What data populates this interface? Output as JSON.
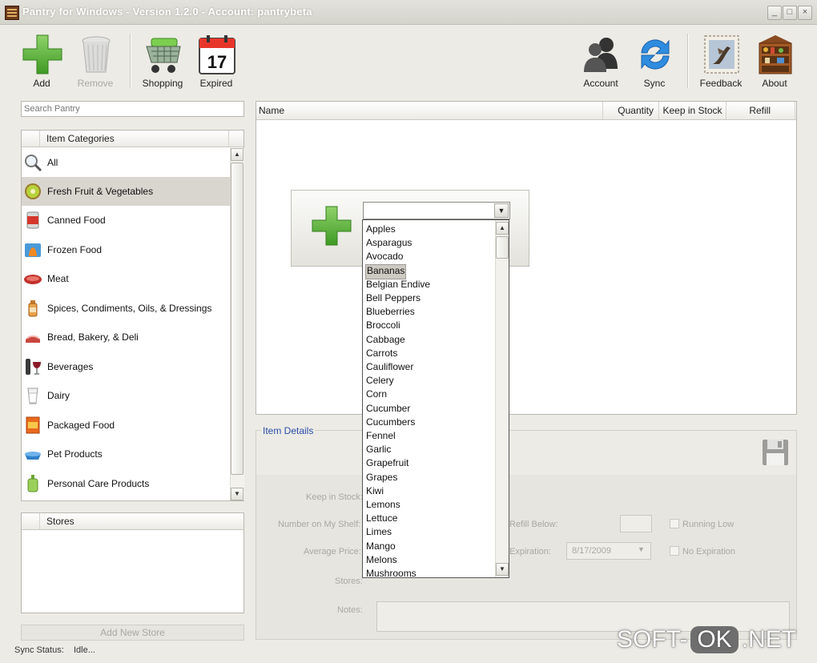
{
  "window": {
    "title": "Pantry for Windows - Version 1.2.0 - Account: pantrybeta",
    "controls": {
      "minimize": "_",
      "maximize": "□",
      "close": "×"
    }
  },
  "toolbar": {
    "left": [
      {
        "label": "Add",
        "icon": "plus-icon",
        "enabled": true
      },
      {
        "label": "Remove",
        "icon": "trash-icon",
        "enabled": false
      },
      {
        "label": "Shopping",
        "icon": "cart-icon",
        "enabled": true
      },
      {
        "label": "Expired",
        "icon": "calendar-icon",
        "enabled": true,
        "calendar_day": "17"
      }
    ],
    "right": [
      {
        "label": "Account",
        "icon": "users-icon"
      },
      {
        "label": "Sync",
        "icon": "sync-icon"
      },
      {
        "label": "Feedback",
        "icon": "stamp-icon"
      },
      {
        "label": "About",
        "icon": "cabinet-icon"
      }
    ]
  },
  "search": {
    "placeholder": "Search Pantry"
  },
  "categories": {
    "header": "Item Categories",
    "items": [
      {
        "label": "All",
        "icon": "magnifier-icon",
        "selected": false
      },
      {
        "label": "Fresh Fruit & Vegetables",
        "icon": "kiwi-icon",
        "selected": true
      },
      {
        "label": "Canned Food",
        "icon": "can-icon",
        "selected": false
      },
      {
        "label": "Frozen Food",
        "icon": "frozen-icon",
        "selected": false
      },
      {
        "label": "Meat",
        "icon": "meat-icon",
        "selected": false
      },
      {
        "label": "Spices, Condiments, Oils, & Dressings",
        "icon": "spice-icon",
        "selected": false
      },
      {
        "label": "Bread, Bakery, & Deli",
        "icon": "bread-icon",
        "selected": false
      },
      {
        "label": "Beverages",
        "icon": "wine-icon",
        "selected": false
      },
      {
        "label": "Dairy",
        "icon": "milk-icon",
        "selected": false
      },
      {
        "label": "Packaged Food",
        "icon": "package-icon",
        "selected": false
      },
      {
        "label": "Pet Products",
        "icon": "pet-bowl-icon",
        "selected": false
      },
      {
        "label": "Personal Care Products",
        "icon": "lotion-icon",
        "selected": false
      }
    ]
  },
  "stores": {
    "header": "Stores",
    "add_button": "Add New Store"
  },
  "status": {
    "label": "Sync Status:",
    "value": "Idle..."
  },
  "item_list": {
    "columns": [
      "Name",
      "Quantity",
      "Keep in Stock",
      "Refill"
    ]
  },
  "add_item": {
    "options": [
      "Apples",
      "Asparagus",
      "Avocado",
      "Bananas",
      "Belgian Endive",
      "Bell Peppers",
      "Blueberries",
      "Broccoli",
      "Cabbage",
      "Carrots",
      "Cauliflower",
      "Celery",
      "Corn",
      "Cucumber",
      "Cucumbers",
      "Fennel",
      "Garlic",
      "Grapefruit",
      "Grapes",
      "Kiwi",
      "Lemons",
      "Lettuce",
      "Limes",
      "Mango",
      "Melons",
      "Mushrooms"
    ],
    "highlighted": "Bananas"
  },
  "details": {
    "title": "Item Details",
    "labels": {
      "keep_in_stock": "Keep in Stock:",
      "number_on_shelf": "Number on My Shelf:",
      "average_price": "Average Price:",
      "stores": "Stores:",
      "notes": "Notes:",
      "refill_below": "Refill Below:",
      "expiration": "Expiration:",
      "running_low": "Running Low",
      "no_expiration": "No Expiration"
    },
    "expiration_value": "8/17/2009"
  },
  "watermark": {
    "left": "SOFT-",
    "mid": "OK",
    "right": ".NET"
  }
}
